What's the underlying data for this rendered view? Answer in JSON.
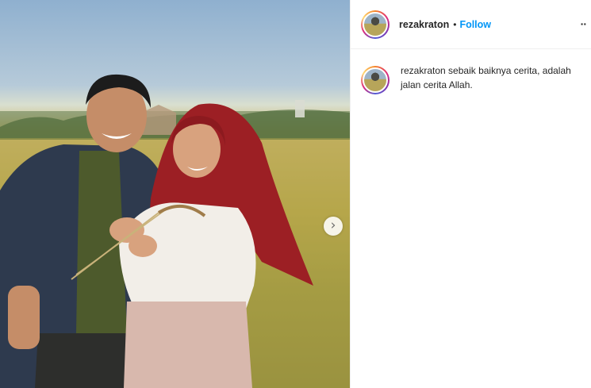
{
  "post": {
    "username": "rezakraton",
    "separator": "•",
    "follow_label": "Follow",
    "more_icon": "more-options-icon",
    "caption_username": "rezakraton",
    "caption_text": "sebaik baiknya cerita, adalah jalan cerita Allah.",
    "carousel_next_glyph": "›"
  },
  "colors": {
    "follow": "#0095f6",
    "text": "#262626",
    "divider": "#efefef"
  }
}
